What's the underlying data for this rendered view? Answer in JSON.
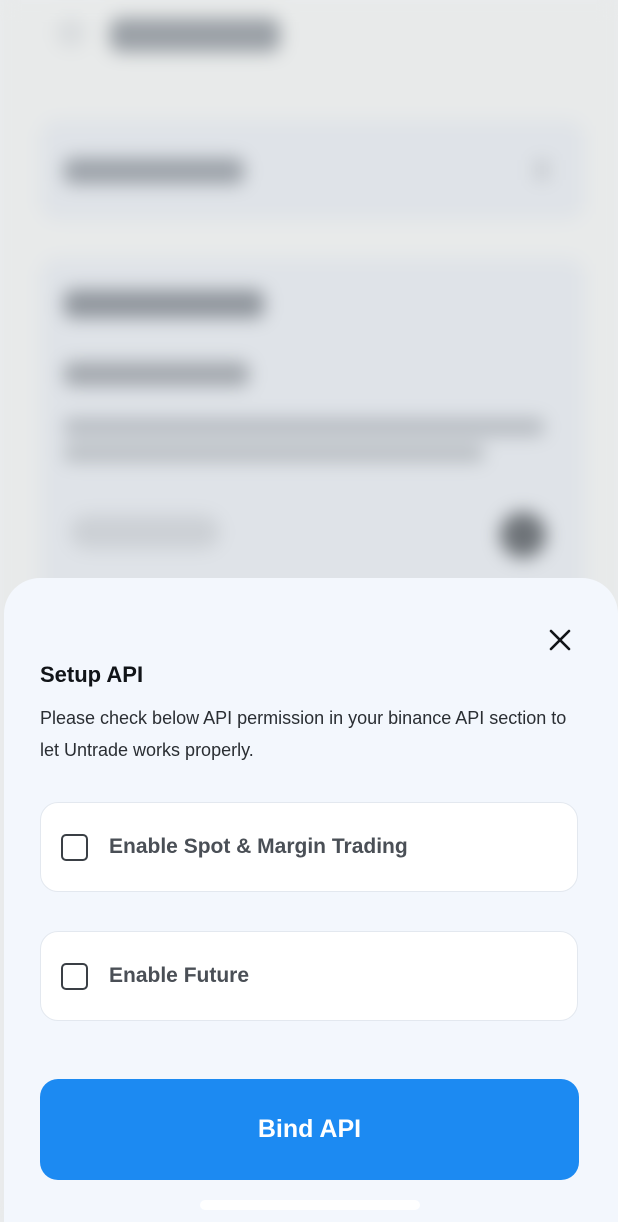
{
  "sheet": {
    "title": "Setup API",
    "description": "Please check below API permission in your binance API section to let Untrade works properly.",
    "options": [
      {
        "label": "Enable Spot & Margin Trading",
        "checked": false
      },
      {
        "label": "Enable Future",
        "checked": false
      }
    ],
    "primary_button": "Bind API",
    "close_icon": "close-icon"
  },
  "colors": {
    "accent": "#1c8af2",
    "sheet_background": "#f3f7fd"
  }
}
